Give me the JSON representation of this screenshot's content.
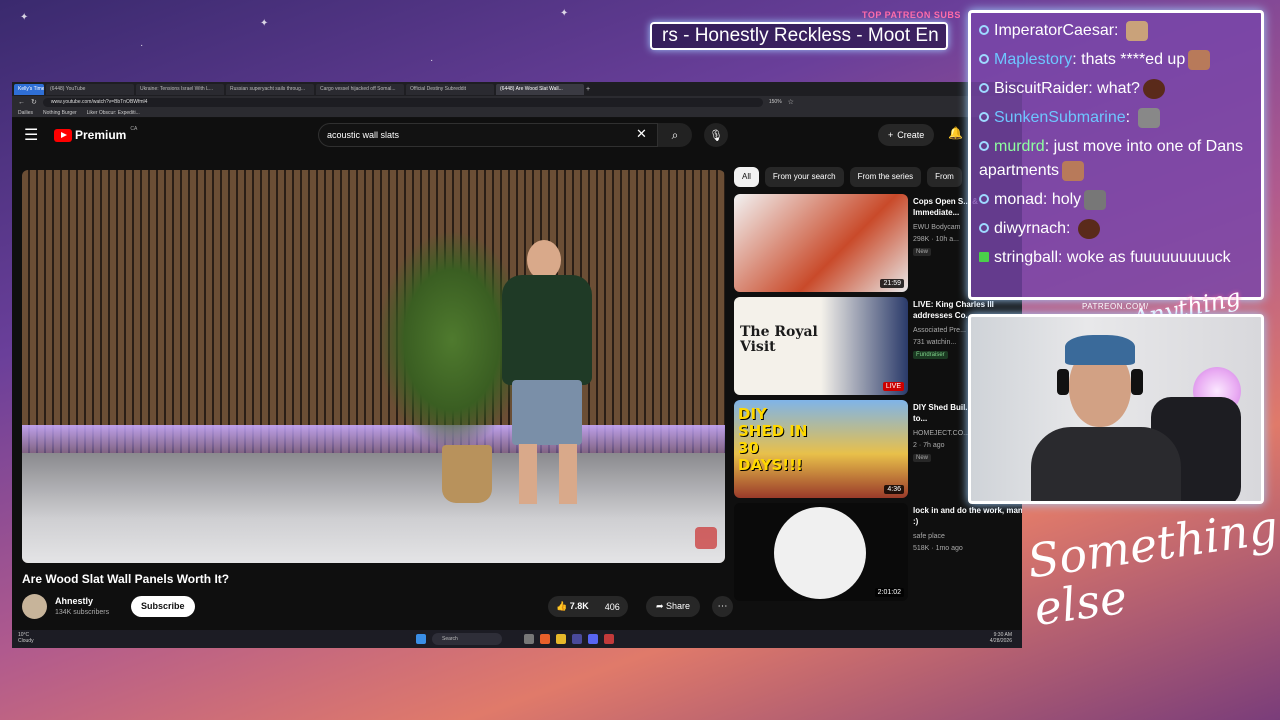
{
  "overlay": {
    "patreon_label": "TOP PATREON SUBS",
    "ticker_text": "rs - Honestly Reckless - Moot En",
    "patreon_url": "PATREON.COM/",
    "script_top": "Anything else?",
    "script_big": "Something else"
  },
  "browser": {
    "tabs": [
      {
        "label": "Kelly's Timer"
      },
      {
        "label": "(6448) YouTube"
      },
      {
        "label": "Ukraine: Tensions Israel With L..."
      },
      {
        "label": "Russian superyacht sails throug..."
      },
      {
        "label": "Cargo vessel hijacked off Somal..."
      },
      {
        "label": "Official Destiny Subreddit"
      },
      {
        "label": "(6448) Are Wood Slat Wall..."
      }
    ],
    "url": "www.youtube.com/watch?v=BbTnOBWfml4",
    "zoom": "150%",
    "bookmarks": [
      "Dailies",
      "Nothing Burger",
      "Liker Obscur: Expediti..."
    ]
  },
  "youtube": {
    "logo_text": "Premium",
    "region": "CA",
    "search_query": "acoustic wall slats",
    "create_label": "Create",
    "video": {
      "title": "Are Wood Slat Wall Panels Worth It?",
      "channel": "Ahnestly",
      "subscribers": "134K subscribers",
      "subscribe_label": "Subscribe",
      "likes": "7.8K",
      "dislikes": "406",
      "share_label": "Share"
    },
    "chips": [
      "All",
      "From your search",
      "From the series",
      "From"
    ],
    "recommendations": [
      {
        "title": "Cops Open S... & Immediate...",
        "channel": "EWU Bodycam",
        "meta": "298K · 10h a...",
        "badge": "New",
        "duration": "21:59"
      },
      {
        "title": "LIVE: King Charles III addresses Co...",
        "channel": "Associated Pre...",
        "meta": "731 watchin...",
        "badge": "Fundraiser",
        "duration": "LIVE",
        "thumb_text": "The Royal Visit"
      },
      {
        "title": "DIY Shed Buil... Days (Start to...",
        "channel": "HOMEJECT.CO...",
        "meta": "2 · 7h ago",
        "badge": "New",
        "duration": "4:36",
        "thumb_text": "DIY SHED IN 30 DAYS!!!"
      },
      {
        "title": "lock in and do the work, man :)",
        "channel": "safe place",
        "meta": "518K · 1mo ago",
        "badge": "",
        "duration": "2:01:02"
      }
    ]
  },
  "taskbar": {
    "weather_temp": "10°C",
    "weather_desc": "Cloudy",
    "search_label": "Search",
    "time": "9:30 AM",
    "date": "4/28/2026"
  },
  "chat": [
    {
      "user": "ImperatorCaesar",
      "text": "",
      "user_color": "#ffffff",
      "emote_color": "#c9a27a",
      "icon": "circle"
    },
    {
      "user": "Maplestory",
      "text": "thats ****ed up",
      "user_color": "#6ec6ff",
      "emote_color": "#b87a5a",
      "icon": "circle"
    },
    {
      "user": "BiscuitRaider",
      "text": "what?",
      "user_color": "#ffffff",
      "emote_color": "#5a2a1a",
      "icon": "circle"
    },
    {
      "user": "SunkenSubmarine",
      "text": "",
      "user_color": "#6ec6ff",
      "emote_color": "#888888",
      "icon": "circle"
    },
    {
      "user": "murdrd",
      "text": "just move into one of Dans apartments",
      "user_color": "#8effa0",
      "emote_color": "#b87a5a",
      "icon": "circle"
    },
    {
      "user": "monad",
      "text": "holy",
      "user_color": "#ffffff",
      "emote_color": "#777777",
      "icon": "circle"
    },
    {
      "user": "diwyrnach",
      "text": "",
      "user_color": "#ffffff",
      "emote_color": "#5a2a1a",
      "icon": "circle"
    },
    {
      "user": "stringball",
      "text": "woke as fuuuuuuuuuck",
      "user_color": "#ffffff",
      "emote_color": "",
      "icon": "k"
    }
  ]
}
